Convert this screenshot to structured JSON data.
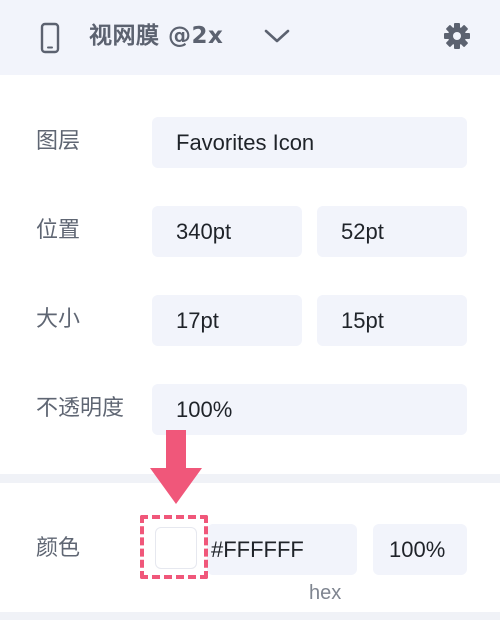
{
  "header": {
    "device_label": "视网膜 @2x",
    "icons": [
      "phone-icon",
      "chevron-down-icon",
      "gear-icon"
    ]
  },
  "layer": {
    "label": "图层",
    "value": "Favorites Icon"
  },
  "position": {
    "label": "位置",
    "x": "340pt",
    "y": "52pt"
  },
  "size": {
    "label": "大小",
    "width": "17pt",
    "height": "15pt"
  },
  "opacity": {
    "label": "不透明度",
    "value": "100%"
  },
  "color": {
    "label": "颜色",
    "swatch": "#FFFFFF",
    "hex": "#FFFFFF",
    "hex_display": "#FFFFFF",
    "alpha": "100%",
    "hex_caption": "hex"
  },
  "colors": {
    "header_bg": "#f2f4fb",
    "field_bg": "#f2f4fb",
    "highlight": "#f0577a"
  }
}
